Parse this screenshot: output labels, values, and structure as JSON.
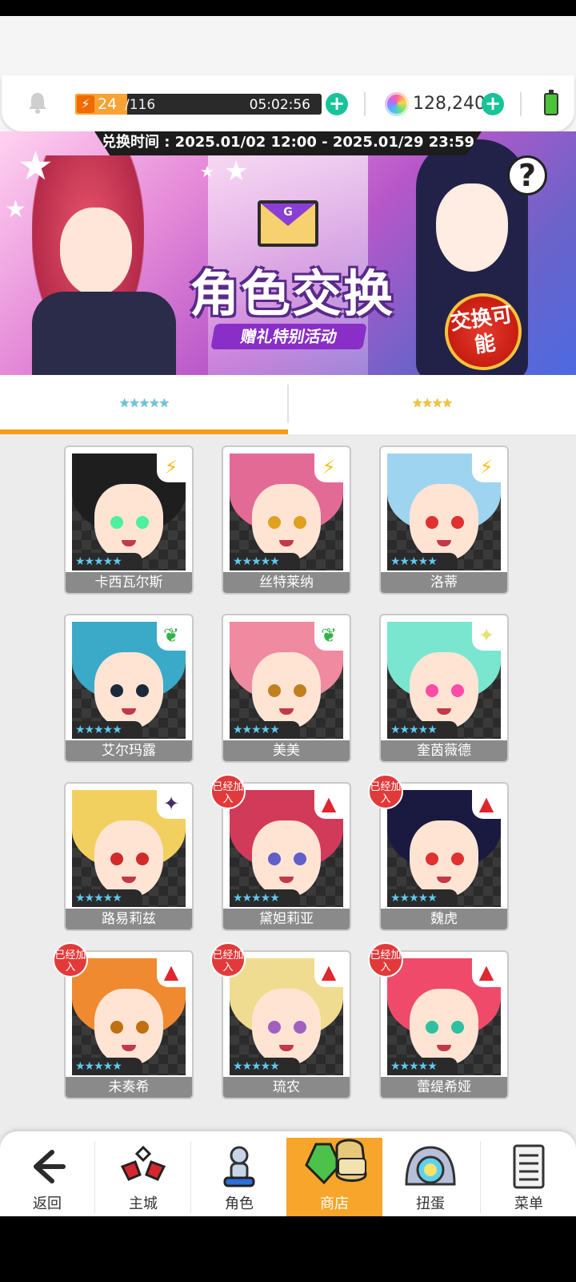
{
  "topbar": {
    "stamina_current": "24",
    "stamina_max": "/116",
    "stamina_fraction": 0.21,
    "stamina_timer": "05:02:56",
    "gems": "128,240"
  },
  "banner": {
    "exchange_period": "兑换时间 : 2025.01/02 12:00 - 2025.01/29 23:59",
    "title": "角色交换",
    "subtitle": "赠礼特别活动",
    "badge": "交换可能",
    "envelope_letter": "G"
  },
  "tabs": [
    {
      "stars": "★★★★★",
      "active": true
    },
    {
      "stars": "★★★★",
      "active": false
    }
  ],
  "characters": [
    {
      "name": "卡西瓦尔斯",
      "element": "lightning-icon",
      "joined": false,
      "hair": "#1e1e1e",
      "eyes": "#4ef0a0"
    },
    {
      "name": "丝特莱纳",
      "element": "lightning-icon",
      "joined": false,
      "hair": "#e46a96",
      "eyes": "#e0a020"
    },
    {
      "name": "洛蒂",
      "element": "lightning-icon",
      "joined": false,
      "hair": "#9fd4f0",
      "eyes": "#e03030"
    },
    {
      "name": "艾尔玛露",
      "element": "leaf-icon",
      "joined": false,
      "hair": "#3aaac8",
      "eyes": "#1a2a3a"
    },
    {
      "name": "美美",
      "element": "leaf-icon",
      "joined": false,
      "hair": "#f08aa0",
      "eyes": "#c08020"
    },
    {
      "name": "奎茵薇德",
      "element": "light-icon",
      "joined": false,
      "hair": "#7ae6d0",
      "eyes": "#ff4aa8"
    },
    {
      "name": "路易莉兹",
      "element": "dark-icon",
      "joined": false,
      "hair": "#f2d060",
      "eyes": "#d02a2a"
    },
    {
      "name": "黛妲莉亚",
      "element": "fire-icon",
      "joined": true,
      "hair": "#d23a5a",
      "eyes": "#6060c8"
    },
    {
      "name": "魏虎",
      "element": "fire-icon",
      "joined": true,
      "hair": "#1a1a40",
      "eyes": "#e03030"
    },
    {
      "name": "未奏希",
      "element": "fire-icon",
      "joined": true,
      "hair": "#f08a30",
      "eyes": "#c07010"
    },
    {
      "name": "琉农",
      "element": "fire-icon",
      "joined": true,
      "hair": "#f0dc90",
      "eyes": "#a060c0"
    },
    {
      "name": "蕾缇希娅",
      "element": "fire-icon",
      "joined": true,
      "hair": "#f04a6a",
      "eyes": "#30c0a0"
    }
  ],
  "card_stars": "★★★★★",
  "joined_label": "已经加入",
  "nav": [
    {
      "label": "返回",
      "icon": "back-arrow-icon",
      "active": false
    },
    {
      "label": "主城",
      "icon": "castle-icon",
      "active": false
    },
    {
      "label": "角色",
      "icon": "character-icon",
      "active": false
    },
    {
      "label": "商店",
      "icon": "shop-icon",
      "active": true
    },
    {
      "label": "扭蛋",
      "icon": "gacha-icon",
      "active": false
    },
    {
      "label": "菜单",
      "icon": "menu-list-icon",
      "active": false
    }
  ],
  "colors": {
    "accent_orange": "#f7a52b",
    "plus_green": "#19c39a",
    "joined_red": "#e23a3a"
  }
}
